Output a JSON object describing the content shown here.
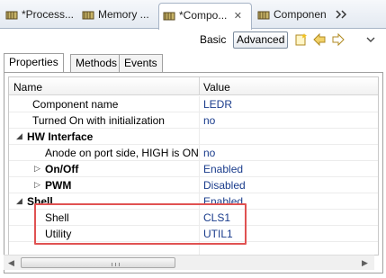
{
  "editor_tabs": [
    {
      "label": "*Process...",
      "icon": "component-editor-icon"
    },
    {
      "label": "Memory ...",
      "icon": "component-editor-icon"
    },
    {
      "label": "*Compo...",
      "icon": "component-editor-icon",
      "close": "✕"
    },
    {
      "label": "Componen",
      "icon": "component-editor-icon"
    }
  ],
  "toolbar": {
    "basic_label": "Basic",
    "advanced_label": "Advanced"
  },
  "inspector_tabs": [
    "Properties",
    "Methods",
    "Events"
  ],
  "grid": {
    "col_name": "Name",
    "col_value": "Value",
    "rows": [
      {
        "name": "Component name",
        "value": "LEDR"
      },
      {
        "name": "Turned On with initialization",
        "value": "no"
      },
      {
        "name": "HW Interface",
        "value": ""
      },
      {
        "name": "Anode on port side, HIGH is ON",
        "value": "no"
      },
      {
        "name": "On/Off",
        "value": "Enabled"
      },
      {
        "name": "PWM",
        "value": "Disabled"
      },
      {
        "name": "Shell",
        "value": "Enabled"
      },
      {
        "name": "Shell",
        "value": "CLS1"
      },
      {
        "name": "Utility",
        "value": "UTIL1"
      }
    ]
  },
  "colors": {
    "highlight": "#e05252",
    "value_text": "#1a3c8c"
  }
}
